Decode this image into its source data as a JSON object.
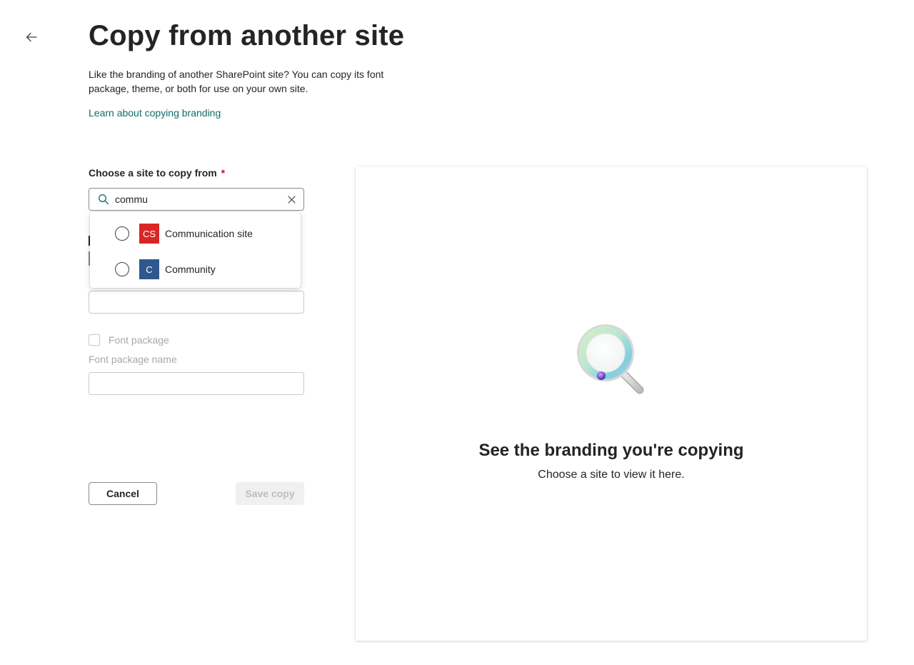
{
  "header": {
    "title": "Copy from another site",
    "description": "Like the branding of another SharePoint site? You can copy its font package, theme, or both for use on your own site.",
    "learn_link": "Learn about copying branding"
  },
  "form": {
    "site_label": "Choose a site to copy from",
    "required_marker": "*",
    "search_value": "commu",
    "options": [
      {
        "initials": "CS",
        "label": "Communication site",
        "color": "#d40000"
      },
      {
        "initials": "C",
        "label": "Community",
        "color": "#0a3a7a"
      }
    ],
    "font_package_checkbox": "Font package",
    "font_package_name_label": "Font package name",
    "cancel_label": "Cancel",
    "save_label": "Save copy"
  },
  "preview": {
    "title": "See the branding you're copying",
    "subtitle": "Choose a site to view it here."
  },
  "colors": {
    "link": "#0f6c6c",
    "required": "#c50f1f"
  }
}
